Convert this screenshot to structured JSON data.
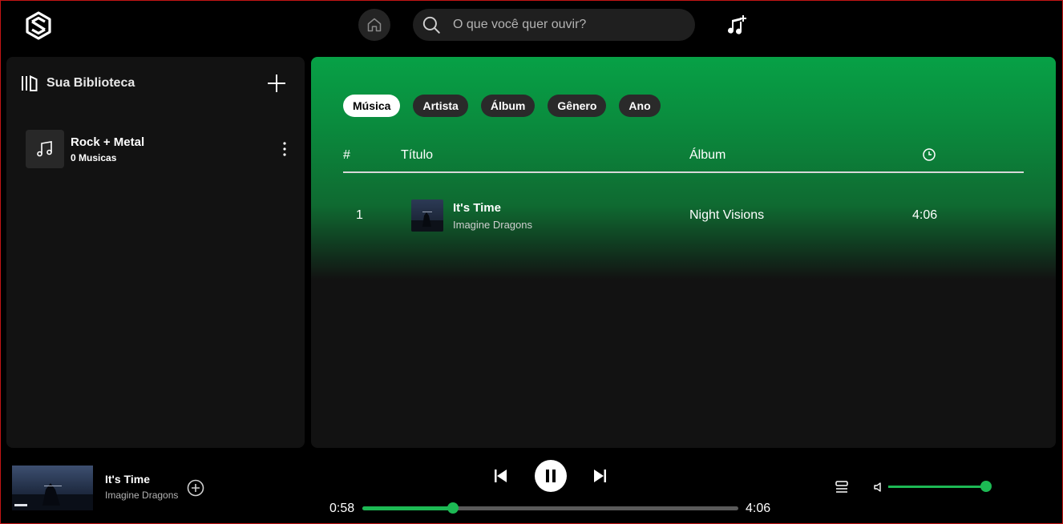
{
  "topbar": {
    "search_placeholder": "O que você quer ouvir?"
  },
  "sidebar": {
    "title": "Sua Biblioteca",
    "playlists": [
      {
        "name": "Rock + Metal",
        "count": "0 Musicas"
      }
    ]
  },
  "main": {
    "filters": [
      "Música",
      "Artista",
      "Álbum",
      "Gênero",
      "Ano"
    ],
    "active_filter": "Música",
    "columns": {
      "num": "#",
      "title": "Título",
      "album": "Álbum"
    },
    "tracks": [
      {
        "num": "1",
        "title": "It's Time",
        "artist": "Imagine Dragons",
        "album": "Night Visions",
        "duration": "4:06"
      }
    ]
  },
  "player": {
    "title": "It's Time",
    "artist": "Imagine Dragons",
    "current_time": "0:58",
    "total_time": "4:06",
    "progress": 0.24,
    "volume": 1.0,
    "accent_color": "#1db954"
  }
}
